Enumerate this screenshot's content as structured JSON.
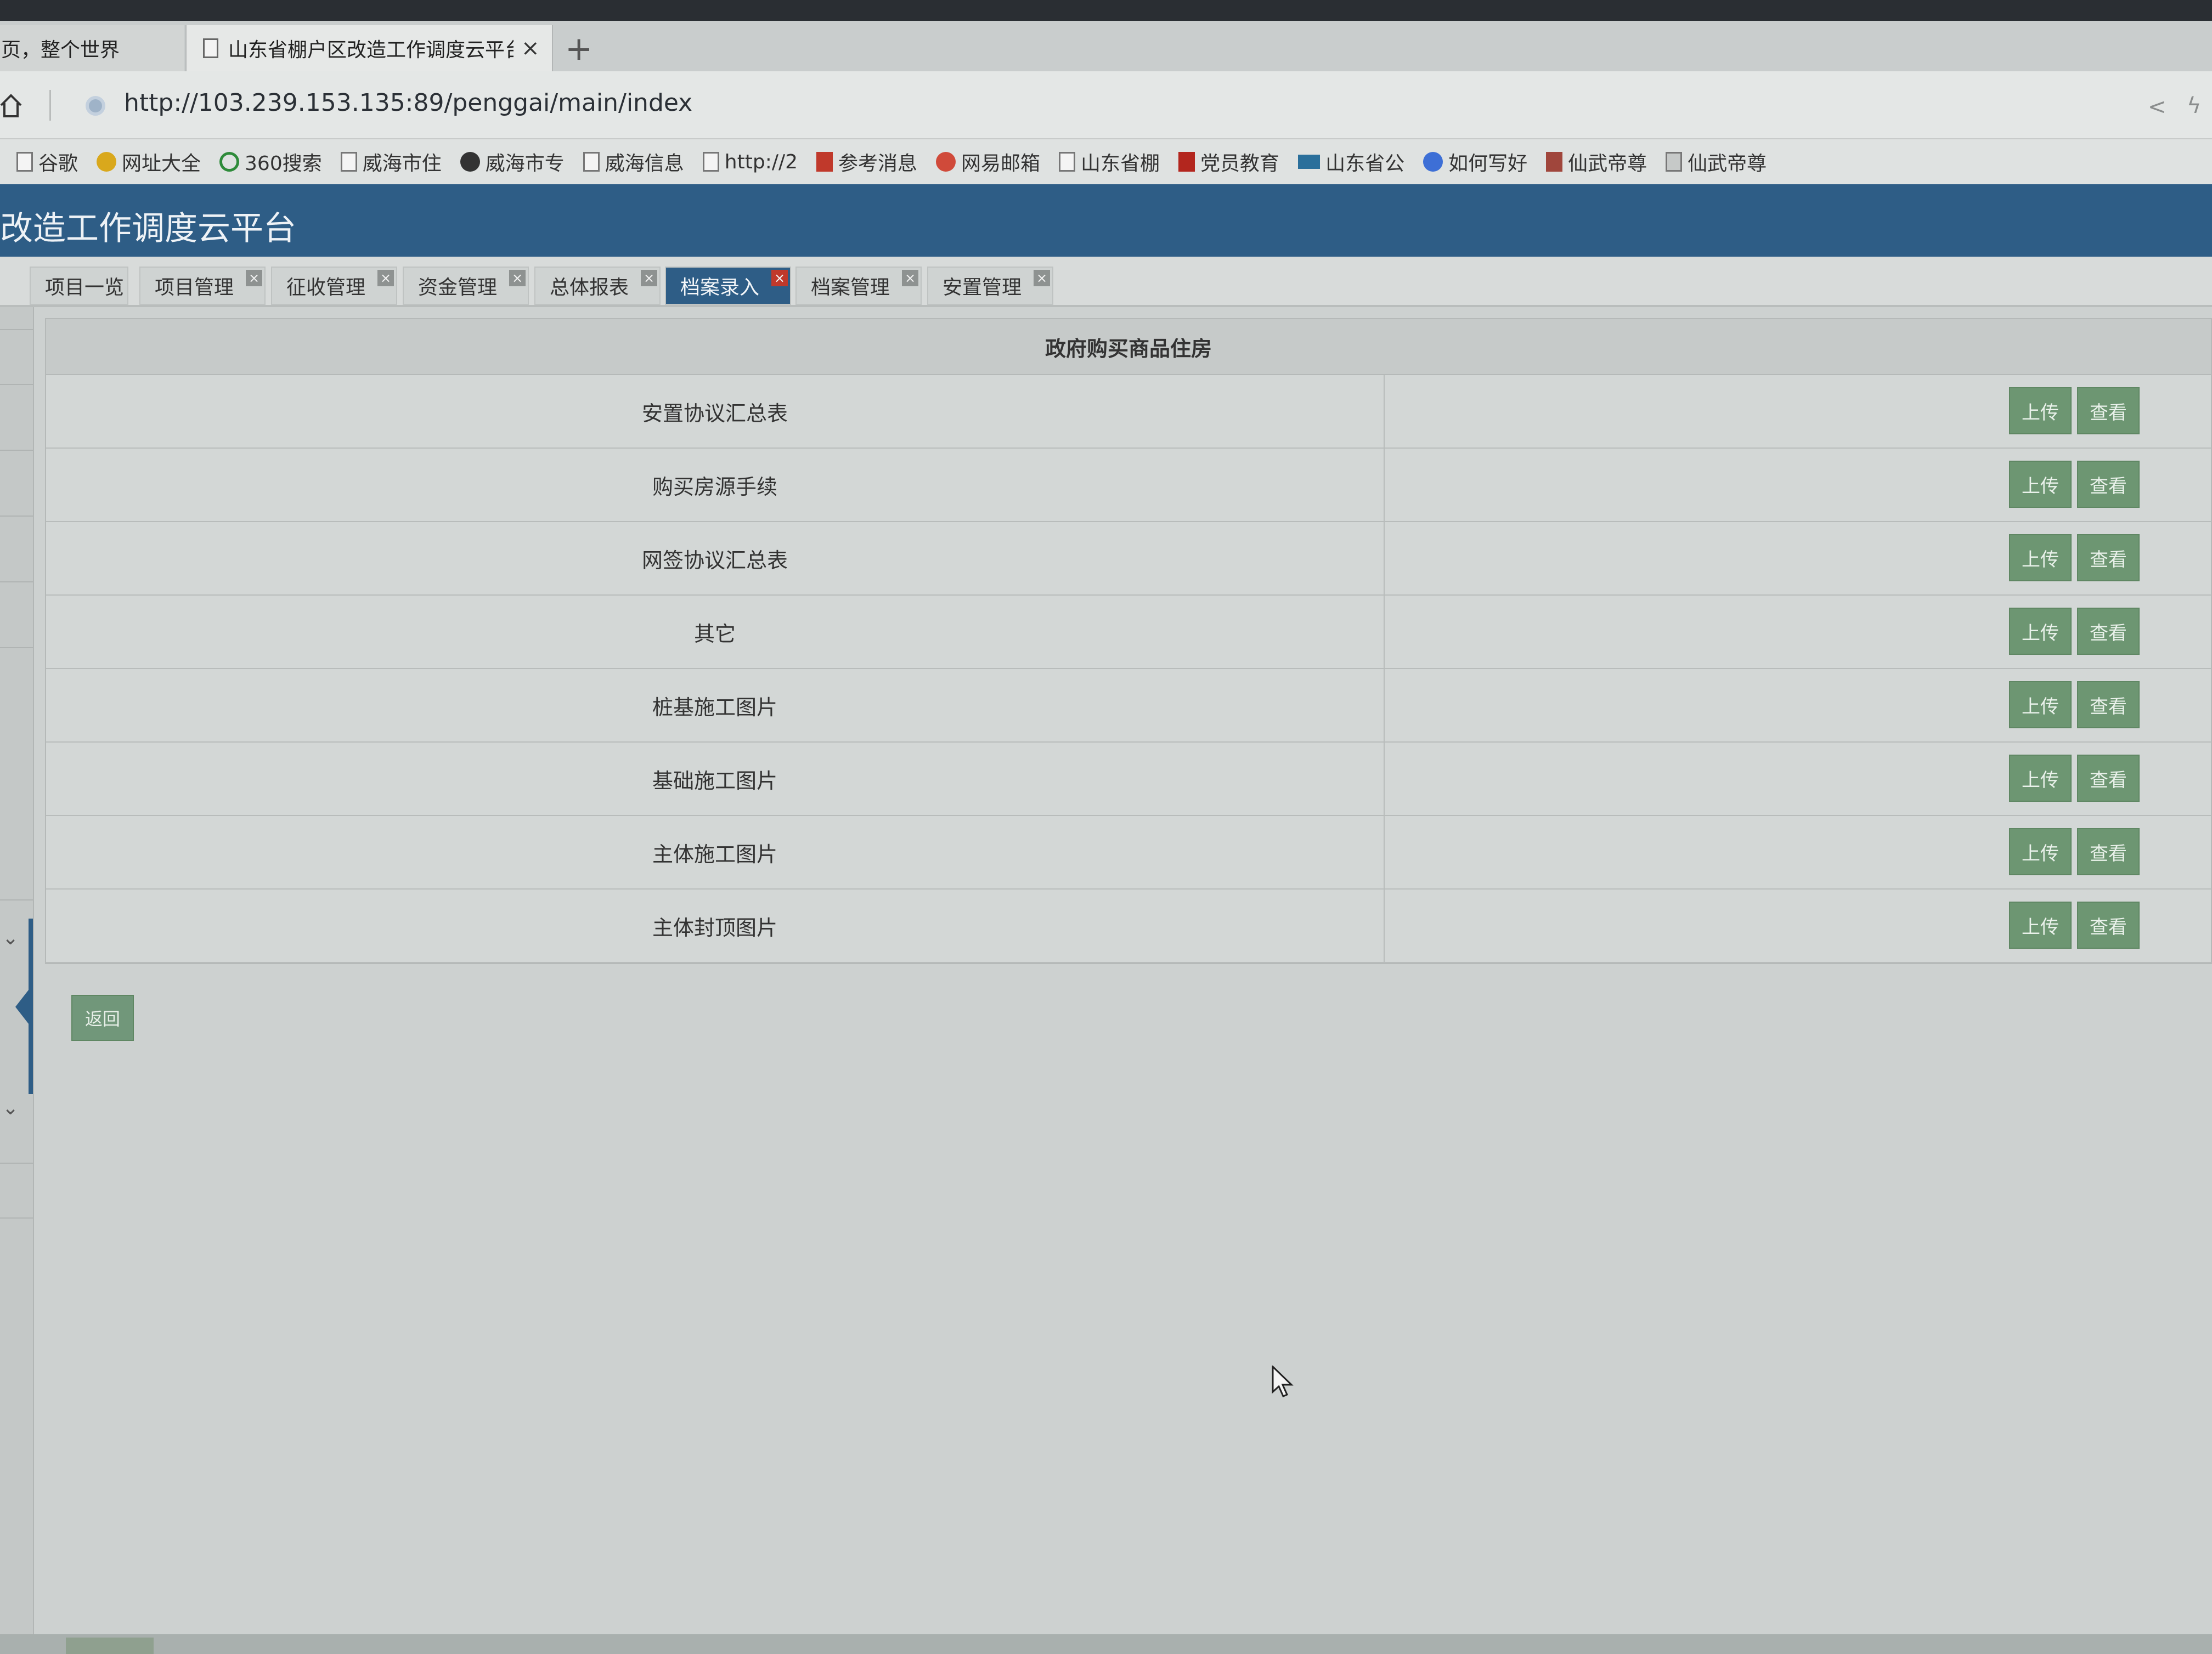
{
  "browser": {
    "tabs": [
      {
        "title": "页，整个世界",
        "active": false
      },
      {
        "title": "山东省棚户区改造工作调度云平台",
        "active": true
      }
    ],
    "new_tab_glyph": "+",
    "close_glyph": "×",
    "url": "http://103.239.153.135:89/penggai/main/index",
    "bookmarks": [
      {
        "label": "谷歌",
        "icon": "doc-icon"
      },
      {
        "label": "网址大全",
        "icon": "plus-circle-icon"
      },
      {
        "label": "360搜索",
        "icon": "search-icon"
      },
      {
        "label": "威海市住",
        "icon": "doc-icon"
      },
      {
        "label": "威海市专",
        "icon": "e-icon"
      },
      {
        "label": "威海信息",
        "icon": "doc-icon"
      },
      {
        "label": "http://2",
        "icon": "doc-icon"
      },
      {
        "label": "参考消息",
        "icon": "news-icon"
      },
      {
        "label": "网易邮箱",
        "icon": "mail-icon"
      },
      {
        "label": "山东省棚",
        "icon": "doc-icon"
      },
      {
        "label": "党员教育",
        "icon": "party-icon"
      },
      {
        "label": "山东省公",
        "icon": "site-icon"
      },
      {
        "label": "如何写好",
        "icon": "paw-icon"
      },
      {
        "label": "仙武帝尊",
        "icon": "book-icon"
      },
      {
        "label": "仙武帝尊",
        "icon": "list-icon"
      }
    ]
  },
  "app": {
    "title": "改造工作调度云平台",
    "tabs": [
      {
        "label": "项目一览",
        "closable": false,
        "active": false
      },
      {
        "label": "项目管理",
        "closable": true,
        "active": false
      },
      {
        "label": "征收管理",
        "closable": true,
        "active": false
      },
      {
        "label": "资金管理",
        "closable": true,
        "active": false
      },
      {
        "label": "总体报表",
        "closable": true,
        "active": false
      },
      {
        "label": "档案录入",
        "closable": true,
        "active": true
      },
      {
        "label": "档案管理",
        "closable": true,
        "active": false
      },
      {
        "label": "安置管理",
        "closable": true,
        "active": false
      }
    ],
    "tab_close_glyph": "×"
  },
  "archive": {
    "section_title": "政府购买商品住房",
    "rows": [
      {
        "name": "安置协议汇总表"
      },
      {
        "name": "购买房源手续"
      },
      {
        "name": "网签协议汇总表"
      },
      {
        "name": "其它"
      },
      {
        "name": "桩基施工图片"
      },
      {
        "name": "基础施工图片"
      },
      {
        "name": "主体施工图片"
      },
      {
        "name": "主体封顶图片"
      }
    ],
    "upload_label": "上传",
    "view_label": "查看",
    "back_label": "返回"
  },
  "colors": {
    "header_blue": "#2e5d86",
    "button_green": "#6d9672",
    "tab_close_red": "#c0392b"
  }
}
